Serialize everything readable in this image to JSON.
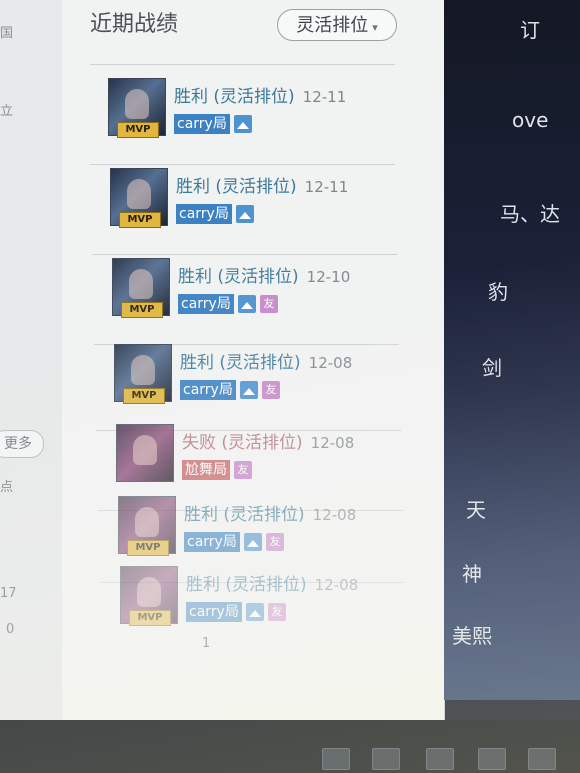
{
  "left_sliver": {
    "fragments": [
      "国",
      "立",
      "更多",
      "点",
      "17",
      "0"
    ],
    "more_label": "更多"
  },
  "panel": {
    "title": "近期战绩",
    "filter": {
      "label": "灵活排位"
    }
  },
  "matches": [
    {
      "result": "胜利 (灵活排位)",
      "date": "12-11",
      "mvp": "MVP",
      "tag": "carry局",
      "has_image_icon": true,
      "has_you_badge": false,
      "avatar": "blue",
      "loss": false
    },
    {
      "result": "胜利 (灵活排位)",
      "date": "12-11",
      "mvp": "MVP",
      "tag": "carry局",
      "has_image_icon": true,
      "has_you_badge": false,
      "avatar": "blue",
      "loss": false
    },
    {
      "result": "胜利 (灵活排位)",
      "date": "12-10",
      "mvp": "MVP",
      "tag": "carry局",
      "has_image_icon": true,
      "has_you_badge": true,
      "you_badge": "友",
      "avatar": "blue",
      "loss": false
    },
    {
      "result": "胜利 (灵活排位)",
      "date": "12-08",
      "mvp": "MVP",
      "tag": "carry局",
      "has_image_icon": true,
      "has_you_badge": true,
      "you_badge": "友",
      "avatar": "blue",
      "loss": false
    },
    {
      "result": "失败 (灵活排位)",
      "date": "12-08",
      "mvp": "",
      "tag": "尬舞局",
      "has_image_icon": false,
      "has_you_badge": true,
      "you_badge": "友",
      "avatar": "purple",
      "loss": true
    },
    {
      "result": "胜利 (灵活排位)",
      "date": "12-08",
      "mvp": "MVP",
      "tag": "carry局",
      "has_image_icon": true,
      "has_you_badge": true,
      "you_badge": "友",
      "avatar": "purple",
      "loss": false
    },
    {
      "result": "胜利 (灵活排位)",
      "date": "12-08",
      "mvp": "MVP",
      "tag": "carry局",
      "has_image_icon": true,
      "has_you_badge": true,
      "you_badge": "友",
      "avatar": "purple",
      "loss": false
    }
  ],
  "pagination": {
    "current": "1"
  },
  "right_window": {
    "fragments": [
      "订",
      "ove",
      "马、达",
      "豹",
      "剑",
      "天",
      "神",
      "美熙"
    ]
  },
  "colors": {
    "accent_blue": "#3c82c3",
    "win_text": "#3c7a9b",
    "mvp_gold": "#e0b640"
  }
}
